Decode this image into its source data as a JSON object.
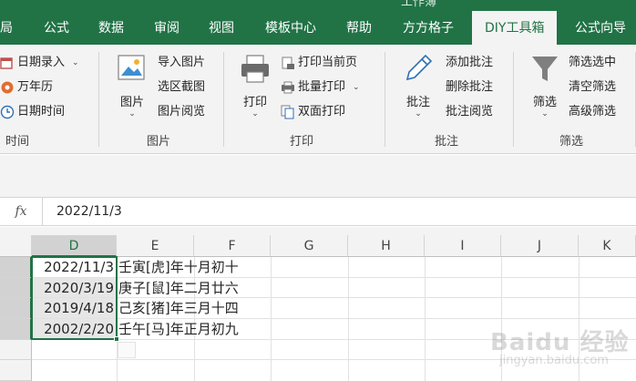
{
  "ribbon_tabs": [
    {
      "label": "局"
    },
    {
      "label": "公式"
    },
    {
      "label": "数据"
    },
    {
      "label": "审阅"
    },
    {
      "label": "视图"
    },
    {
      "label": "模板中心"
    },
    {
      "label": "帮助"
    },
    {
      "label": "方方格子"
    },
    {
      "label": "DIY工具箱",
      "active": true
    },
    {
      "label": "公式向导"
    }
  ],
  "window_title_partial": "工作簿",
  "groups": {
    "time": {
      "label": "时间",
      "items": [
        "日期录入",
        "万年历",
        "日期时间"
      ]
    },
    "picture": {
      "label": "图片",
      "big_button": "图片",
      "items": [
        "导入图片",
        "选区截图",
        "图片阅览"
      ]
    },
    "print": {
      "label": "打印",
      "big_button": "打印",
      "items": [
        "打印当前页",
        "批量打印",
        "双面打印"
      ]
    },
    "comment": {
      "label": "批注",
      "big_button": "批注",
      "items": [
        "添加批注",
        "删除批注",
        "批注阅览"
      ]
    },
    "filter": {
      "label": "筛选",
      "big_button": "筛选",
      "items": [
        "筛选选中",
        "清空筛选",
        "高级筛选"
      ]
    }
  },
  "formula_bar": {
    "fx": "fx",
    "value": "2022/11/3"
  },
  "columns": [
    "D",
    "E",
    "F",
    "G",
    "H",
    "I",
    "J",
    "K"
  ],
  "selected_column": "D",
  "rows": [
    {
      "date": "2022/11/3",
      "lunar": "壬寅[虎]年十月初十"
    },
    {
      "date": "2020/3/19",
      "lunar": "庚子[鼠]年二月廿六"
    },
    {
      "date": "2019/4/18",
      "lunar": "己亥[猪]年三月十四"
    },
    {
      "date": "2002/2/20",
      "lunar": "壬午[马]年正月初九"
    }
  ],
  "watermark": {
    "text": "Baidu 经验",
    "sub": "jingyan.baidu.com"
  },
  "colors": {
    "accent": "#217346",
    "ribbon_bg": "#f3f3f3"
  }
}
